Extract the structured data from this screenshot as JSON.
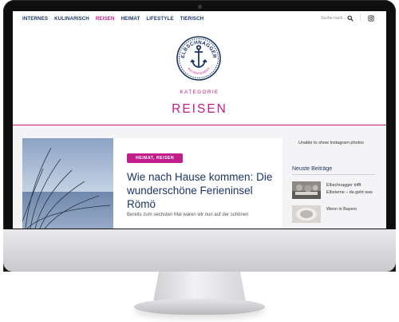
{
  "nav": {
    "items": [
      {
        "label": "INTERNES",
        "active": false
      },
      {
        "label": "KULINARISCH",
        "active": false
      },
      {
        "label": "REISEN",
        "active": true
      },
      {
        "label": "HEIMAT",
        "active": false
      },
      {
        "label": "LIFESTYLE",
        "active": false
      },
      {
        "label": "TIERISCH",
        "active": false
      }
    ],
    "search_placeholder": "Suche nach...",
    "search_icon": "search-icon",
    "social_icon": "instagram-icon"
  },
  "logo": {
    "name": "ELBSCHNAGGER",
    "tagline": "AUS DEM NORDEN",
    "icon": "anchor-icon"
  },
  "category": {
    "label": "KATEGORIE",
    "title": "REISEN"
  },
  "post": {
    "tag": "HEIMAT, REISEN",
    "title": "Wie nach Hause kommen: Die wunderschöne Ferieninsel Römö",
    "excerpt": "Bereits zum sechsten Mal waren wir nun auf der schönen"
  },
  "sidebar": {
    "instagram_message": "Unable to show Instagram photos",
    "recent_heading": "Neuste Beiträge",
    "recent_posts": [
      {
        "title": "Elbschnagger trifft Elbsterne – da geht was"
      },
      {
        "title": "Wenn in Bayern"
      }
    ]
  },
  "colors": {
    "accent": "#c21d8a",
    "navy": "#1b3566",
    "rule": "#d5177b"
  }
}
